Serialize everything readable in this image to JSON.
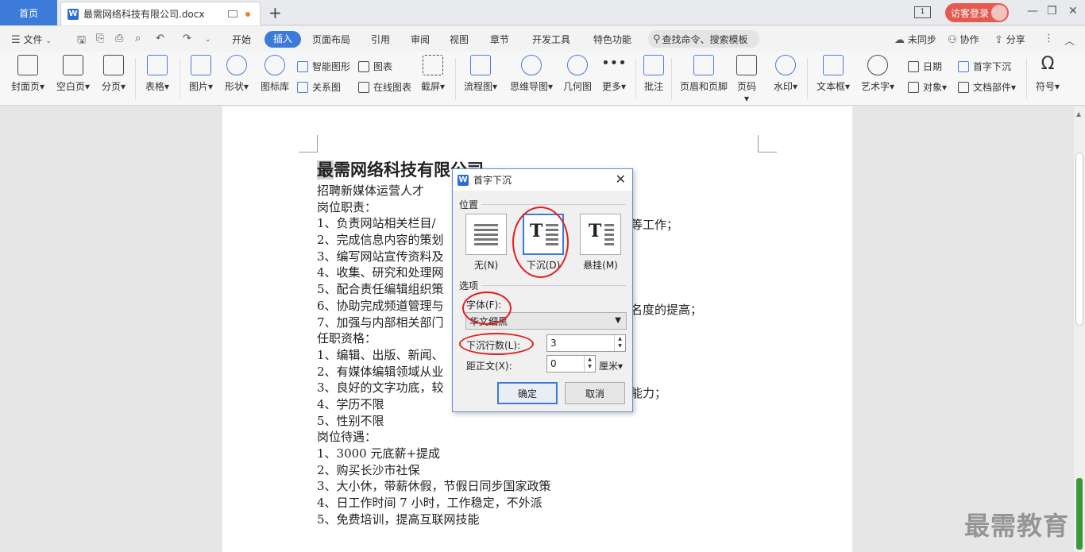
{
  "tabbar": {
    "home": "首页",
    "doc_tab": "最需网络科技有限公司.docx",
    "doc_icon": "W",
    "add": "+",
    "screen_badge": "1",
    "guest_login": "访客登录"
  },
  "menubar": {
    "file": "文件",
    "items": [
      "开始",
      "插入",
      "页面布局",
      "引用",
      "审阅",
      "视图",
      "章节",
      "开发工具",
      "特色功能"
    ],
    "search": "查找命令、搜索模板",
    "unsync": "未同步",
    "collab": "协作",
    "share": "分享"
  },
  "ribbon": {
    "cover": "封面页",
    "blank": "空白页",
    "pagebreak": "分页",
    "table": "表格",
    "picture": "图片",
    "shape": "形状",
    "iconlib": "图标库",
    "smartart": "智能图形",
    "chart": "图表",
    "relation": "关系图",
    "online_chart": "在线图表",
    "screenshot": "截屏",
    "flowchart": "流程图",
    "mindmap": "思维导图",
    "geometry": "几何图",
    "more": "更多",
    "comment": "批注",
    "header_footer": "页眉和页脚",
    "pagenum": "页码",
    "watermark": "水印",
    "textbox": "文本框",
    "wordart": "艺术字",
    "date": "日期",
    "object": "对象",
    "dropcap": "首字下沉",
    "docparts": "文档部件",
    "symbol": "符号"
  },
  "document": {
    "heading_first": "最",
    "heading_rest": "需网络科技有限公司",
    "lines": [
      "招聘新媒体运营人才",
      "岗位职责：",
      "1、负责网站相关栏目/",
      "2、完成信息内容的策划",
      "3、编写网站宣传资料及",
      "4、收集、研究和处理网",
      "5、配合责任编辑组织策",
      "6、协助完成频道管理与",
      "7、加强与内部相关部门",
      "任职资格：",
      "1、编辑、出版、新闻、",
      "2、有媒体编辑领域从业",
      "3、良好的文字功底，较",
      "4、学历不限",
      "5、性别不限",
      "岗位待遇：",
      "1、3000 元底薪+提成",
      "2、购买长沙市社保",
      "3、大小休，带薪休假，节假日同步国家政策",
      "4、日工作时间 7 小时，工作稳定，不外派",
      "5、免费培训，提高互联网技能"
    ],
    "frag_line3": "等工作；",
    "frag_line8": "名度的提高；",
    "frag_line13": "能力；"
  },
  "watermark_text": "最需教育",
  "dialog": {
    "title": "首字下沉",
    "position_group": "位置",
    "pos_none": "无(N)",
    "pos_drop": "下沉(D)",
    "pos_margin": "悬挂(M)",
    "options_group": "选项",
    "font_label": "字体(F):",
    "font_value": "华文细黑",
    "lines_label": "下沉行数(L):",
    "lines_value": "3",
    "distance_label": "距正文(X):",
    "distance_value": "0",
    "unit": "厘米",
    "ok": "确定",
    "cancel": "取消",
    "big_t": "T"
  },
  "colors": {
    "accent": "#3c7bd8",
    "guest_button": "#e55a4f",
    "annotation": "#e02020"
  }
}
